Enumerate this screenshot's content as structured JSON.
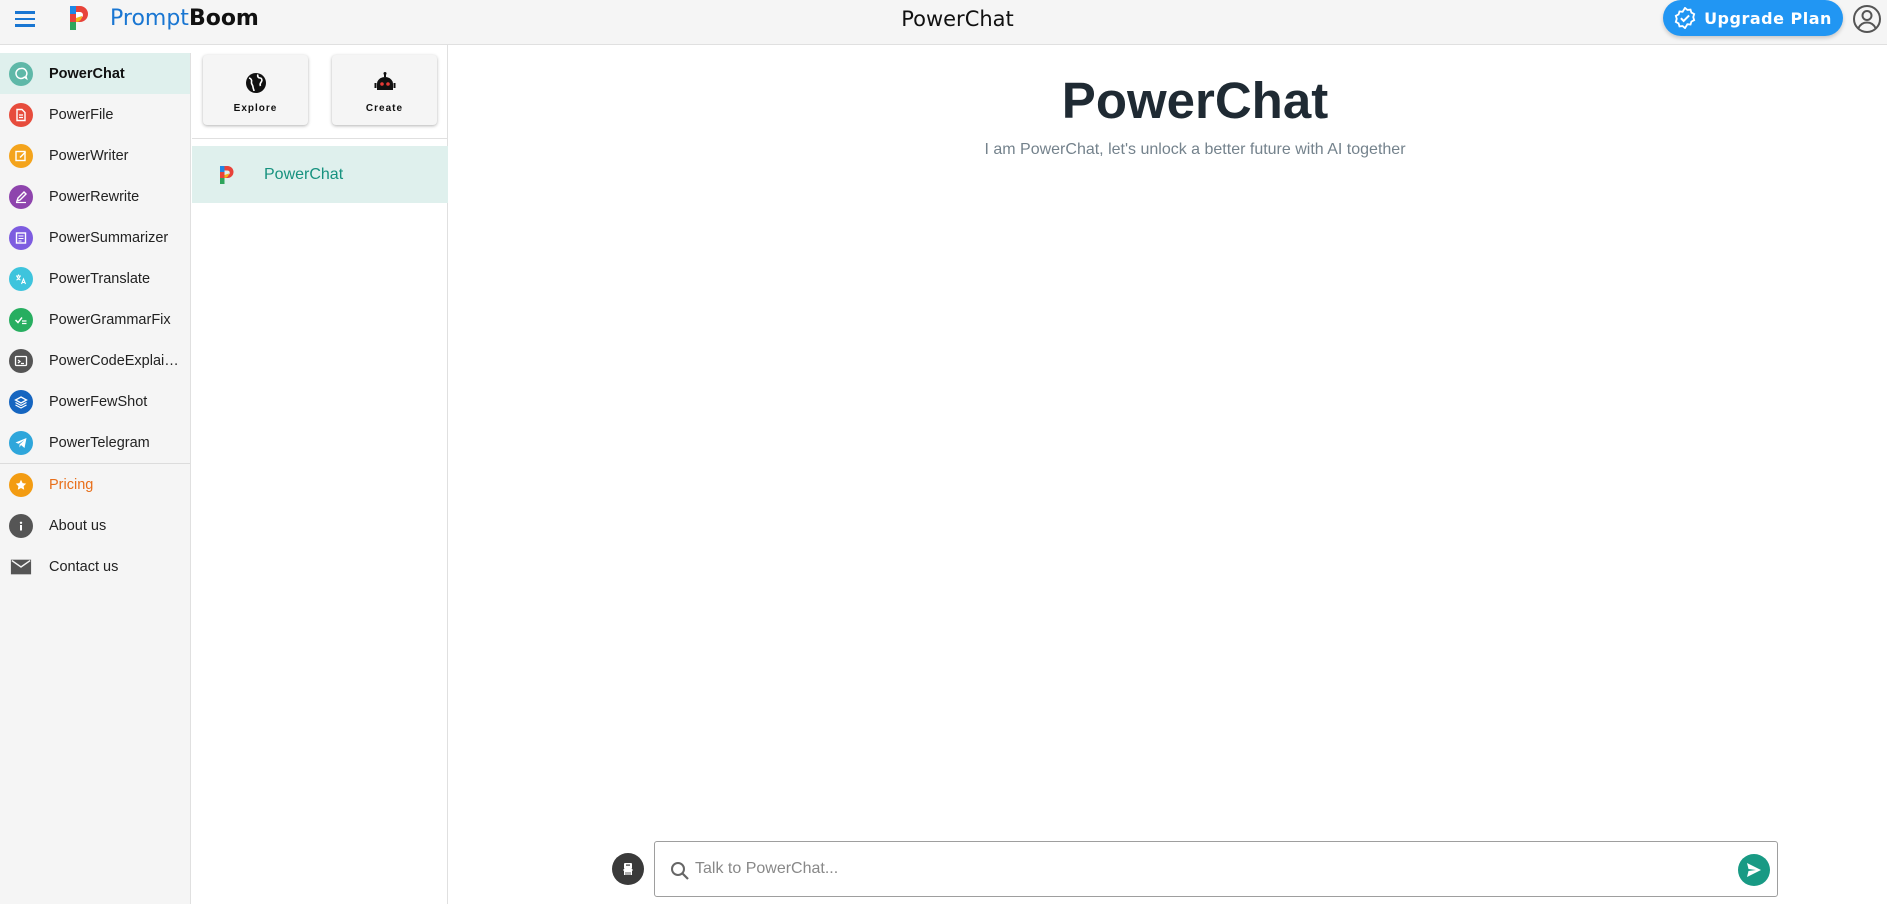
{
  "header": {
    "brand_part1": "Prompt",
    "brand_part2": "Boom",
    "title": "PowerChat",
    "upgrade_label": "Upgrade Plan"
  },
  "nav": {
    "items": [
      {
        "label": "PowerChat",
        "icon": "chat-icon",
        "color": "#5fb8a8"
      },
      {
        "label": "PowerFile",
        "icon": "file-icon",
        "color": "#e74c3c"
      },
      {
        "label": "PowerWriter",
        "icon": "edit-icon",
        "color": "#f4a41c"
      },
      {
        "label": "PowerRewrite",
        "icon": "pen-icon",
        "color": "#8e44ad"
      },
      {
        "label": "PowerSummarizer",
        "icon": "summary-icon",
        "color": "#7d5ce0"
      },
      {
        "label": "PowerTranslate",
        "icon": "translate-icon",
        "color": "#3ec4dd"
      },
      {
        "label": "PowerGrammarFix",
        "icon": "grammar-icon",
        "color": "#27ae60"
      },
      {
        "label": "PowerCodeExplainer",
        "icon": "terminal-icon",
        "color": "#555555"
      },
      {
        "label": "PowerFewShot",
        "icon": "layers-icon",
        "color": "#1565c0"
      },
      {
        "label": "PowerTelegram",
        "icon": "telegram-icon",
        "color": "#2ea6db"
      }
    ],
    "secondary": [
      {
        "label": "Pricing",
        "icon": "star-icon",
        "color": "#f39c12"
      },
      {
        "label": "About us",
        "icon": "info-icon",
        "color": "#555555"
      },
      {
        "label": "Contact us",
        "icon": "mail-icon",
        "color": "#555555"
      }
    ]
  },
  "tools": {
    "explore_label": "Explore",
    "create_label": "Create"
  },
  "chat_list": {
    "items": [
      {
        "label": "PowerChat"
      }
    ]
  },
  "main": {
    "title": "PowerChat",
    "subtitle": "I am PowerChat, let's unlock a better future with AI together",
    "input_placeholder": "Talk to PowerChat..."
  },
  "colors": {
    "accent": "#2196f3",
    "active_bg": "#dff0ed",
    "teal": "#189a84"
  }
}
